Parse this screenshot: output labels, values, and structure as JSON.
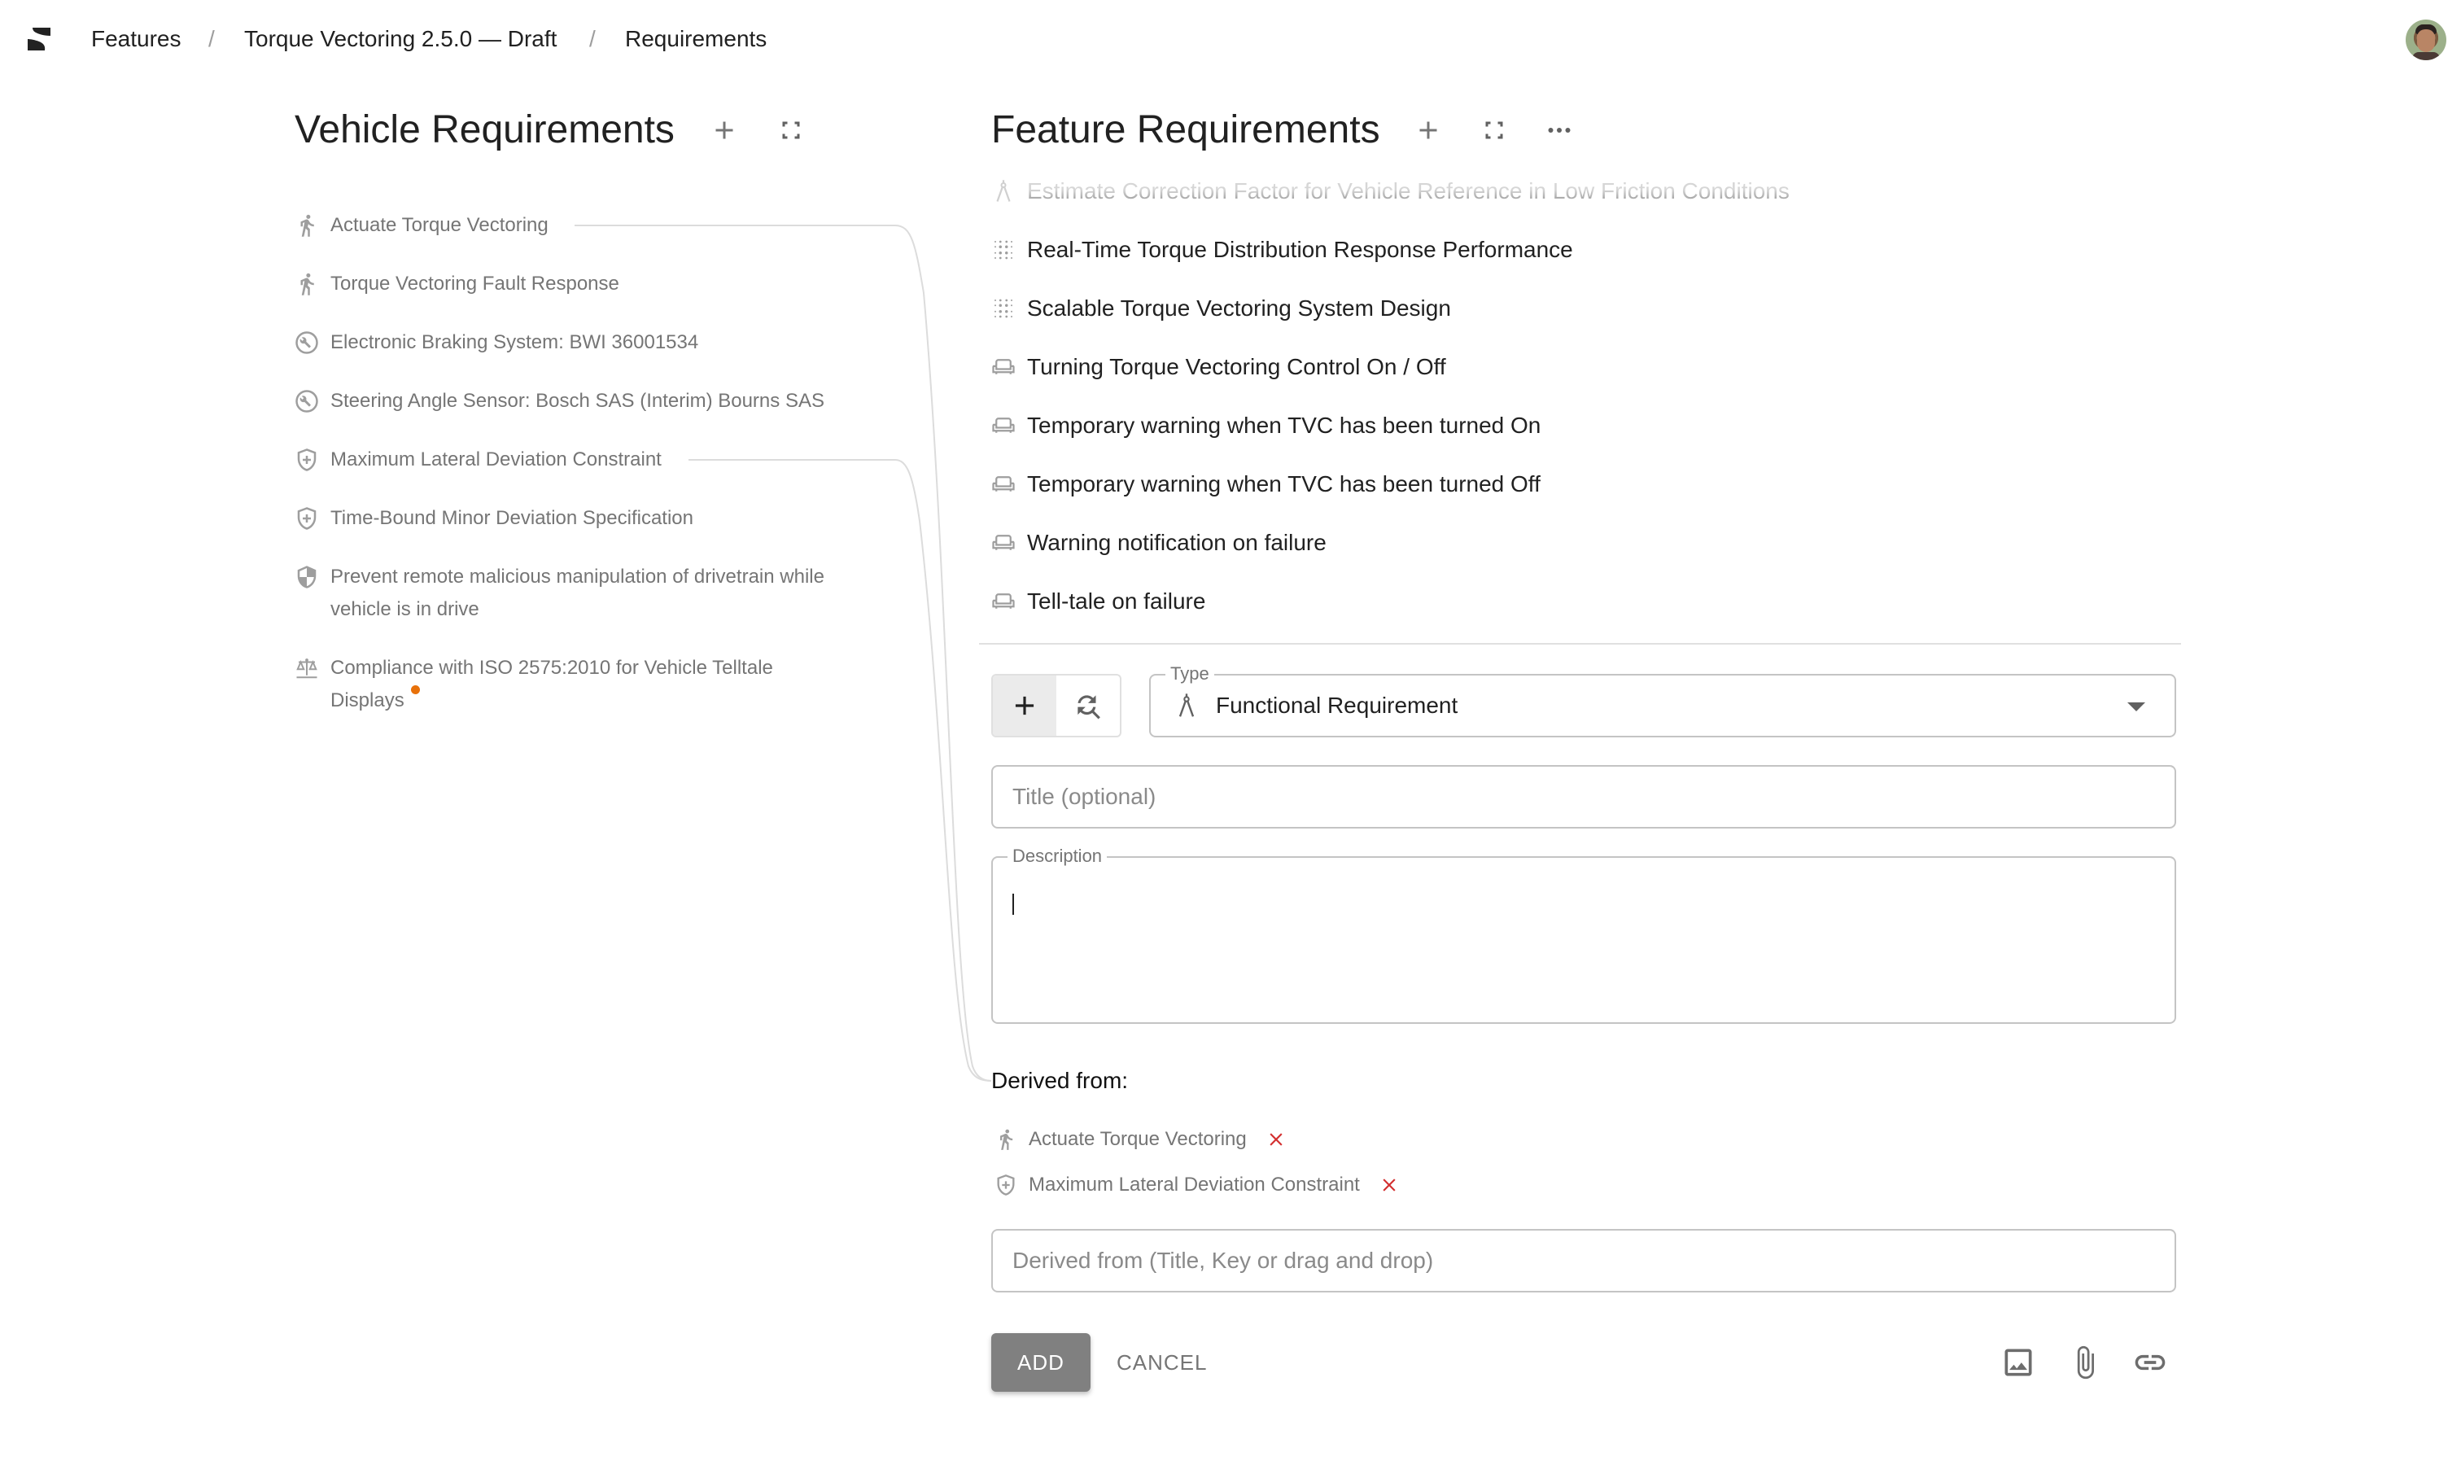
{
  "breadcrumb": {
    "items": [
      "Features",
      "Torque Vectoring 2.5.0 — Draft",
      "Requirements"
    ],
    "separator": "/"
  },
  "user": {
    "avatar": "user-avatar"
  },
  "vehicle_requirements": {
    "title": "Vehicle Requirements",
    "actions": [
      "add-icon",
      "fullscreen-icon"
    ],
    "items": [
      {
        "label": "Actuate Torque Vectoring",
        "icon": "walking-person-icon",
        "linked": true
      },
      {
        "label": "Torque Vectoring Fault Response",
        "icon": "walking-person-icon"
      },
      {
        "label": "Electronic Braking System: BWI 36001534",
        "icon": "wrench-circle-icon"
      },
      {
        "label": "Steering Angle Sensor: Bosch SAS (Interim) Bourns SAS",
        "icon": "wrench-circle-icon"
      },
      {
        "label": "Maximum Lateral Deviation Constraint",
        "icon": "shield-plus-icon",
        "linked": true
      },
      {
        "label": "Time-Bound Minor Deviation Specification",
        "icon": "shield-plus-icon"
      },
      {
        "label": "Prevent remote malicious manipulation of drivetrain while vehicle is in drive",
        "icon": "security-shield-icon"
      },
      {
        "label": "Compliance with ISO 2575:2010 for Vehicle Telltale Displays",
        "icon": "scale-icon",
        "badge_color": "#e8710a"
      }
    ]
  },
  "feature_requirements": {
    "title": "Feature Requirements",
    "actions": [
      "add-icon",
      "fullscreen-icon",
      "more-icon"
    ],
    "items": [
      {
        "label": "Estimate Correction Factor for Vehicle Reference in Low Friction Conditions",
        "icon": "compass-icon",
        "faded": true
      },
      {
        "label": "Real-Time Torque Distribution Response Performance",
        "icon": "dot-grid-icon"
      },
      {
        "label": "Scalable Torque Vectoring System Design",
        "icon": "dot-grid-icon"
      },
      {
        "label": "Turning Torque Vectoring Control On / Off",
        "icon": "seat-icon"
      },
      {
        "label": "Temporary warning when TVC has been turned On",
        "icon": "seat-icon"
      },
      {
        "label": "Temporary warning when TVC has been turned Off",
        "icon": "seat-icon"
      },
      {
        "label": "Warning notification on failure",
        "icon": "seat-icon"
      },
      {
        "label": "Tell-tale on failure",
        "icon": "seat-icon"
      }
    ]
  },
  "form": {
    "mode_buttons": [
      {
        "name": "add-new",
        "icon": "plus-icon",
        "active": true
      },
      {
        "name": "find-existing",
        "icon": "search-refresh-icon",
        "active": false
      }
    ],
    "type_label": "Type",
    "type_value": "Functional Requirement",
    "type_icon": "compass-icon",
    "title_placeholder": "Title (optional)",
    "title_value": "",
    "description_label": "Description",
    "description_value": "",
    "derived_heading": "Derived from:",
    "derived_items": [
      {
        "label": "Actuate Torque Vectoring",
        "icon": "walking-person-icon"
      },
      {
        "label": "Maximum Lateral Deviation Constraint",
        "icon": "shield-plus-icon"
      }
    ],
    "derived_placeholder": "Derived from (Title, Key or drag and drop)",
    "add_label": "ADD",
    "cancel_label": "CANCEL",
    "toolbar_icons": [
      "image-icon",
      "attachment-icon",
      "link-icon"
    ]
  },
  "colors": {
    "remove": "#d32f2f",
    "badge": "#e8710a",
    "add_button": "#808080",
    "muted_text": "#757575"
  }
}
